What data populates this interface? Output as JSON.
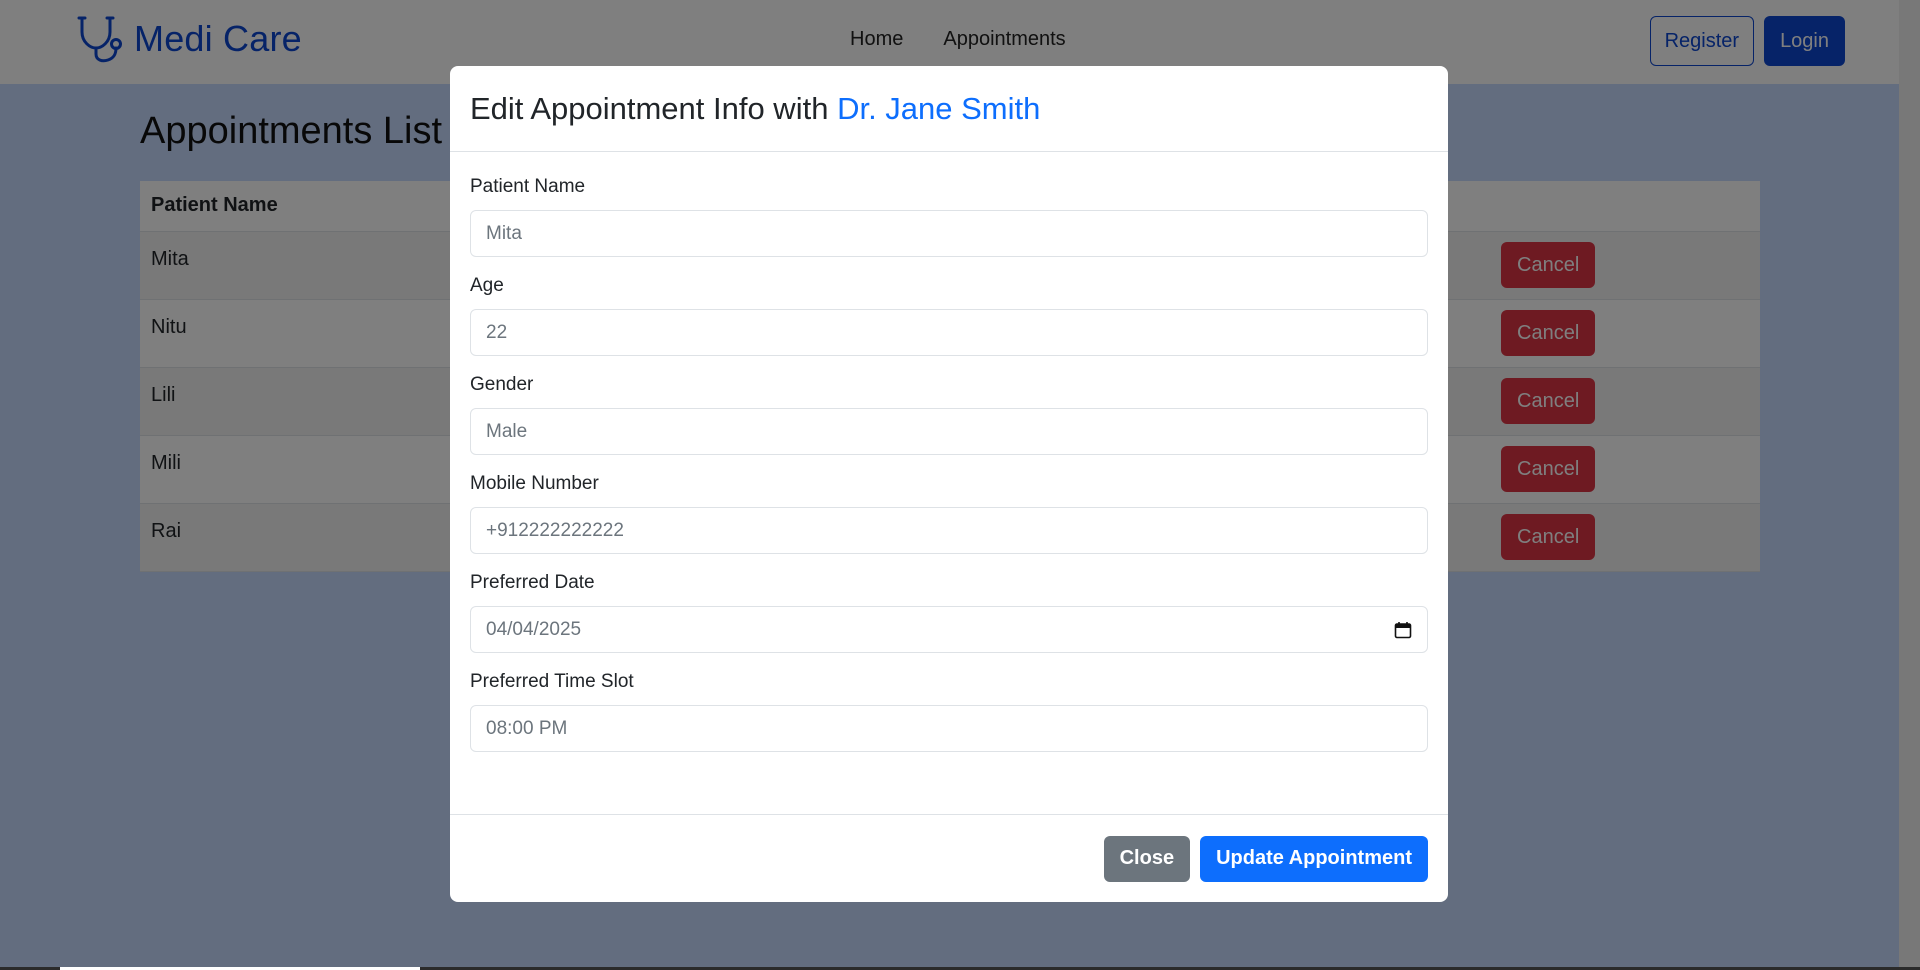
{
  "navbar": {
    "brand": "Medi Care",
    "brand_icon": "stethoscope-icon",
    "links": [
      "Home",
      "Appointments"
    ],
    "register_label": "Register",
    "login_label": "Login"
  },
  "page": {
    "title": "Appointments List",
    "table": {
      "headers": [
        "Patient Name"
      ],
      "rows": [
        {
          "patient": "Mita",
          "action": "Cancel"
        },
        {
          "patient": "Nitu",
          "action": "Cancel"
        },
        {
          "patient": "Lili",
          "action": "Cancel"
        },
        {
          "patient": "Mili",
          "action": "Cancel"
        },
        {
          "patient": "Rai",
          "action": "Cancel"
        }
      ]
    }
  },
  "modal": {
    "title_prefix": "Edit Appointment Info with ",
    "doctor": "Dr. Jane Smith",
    "fields": [
      {
        "label": "Patient Name",
        "value": "Mita"
      },
      {
        "label": "Age",
        "value": "22"
      },
      {
        "label": "Gender",
        "value": "Male"
      },
      {
        "label": "Mobile Number",
        "value": "+912222222222"
      },
      {
        "label": "Preferred Date",
        "value": "04/04/2025",
        "icon": "calendar-icon"
      },
      {
        "label": "Preferred Time Slot",
        "value": "08:00 PM"
      }
    ],
    "close_label": "Close",
    "update_label": "Update Appointment"
  },
  "colors": {
    "brand": "#0d47d0",
    "primary": "#0d6efd",
    "danger": "#dc3545",
    "secondary": "#6c757d",
    "page_background": "#c7dbff"
  }
}
